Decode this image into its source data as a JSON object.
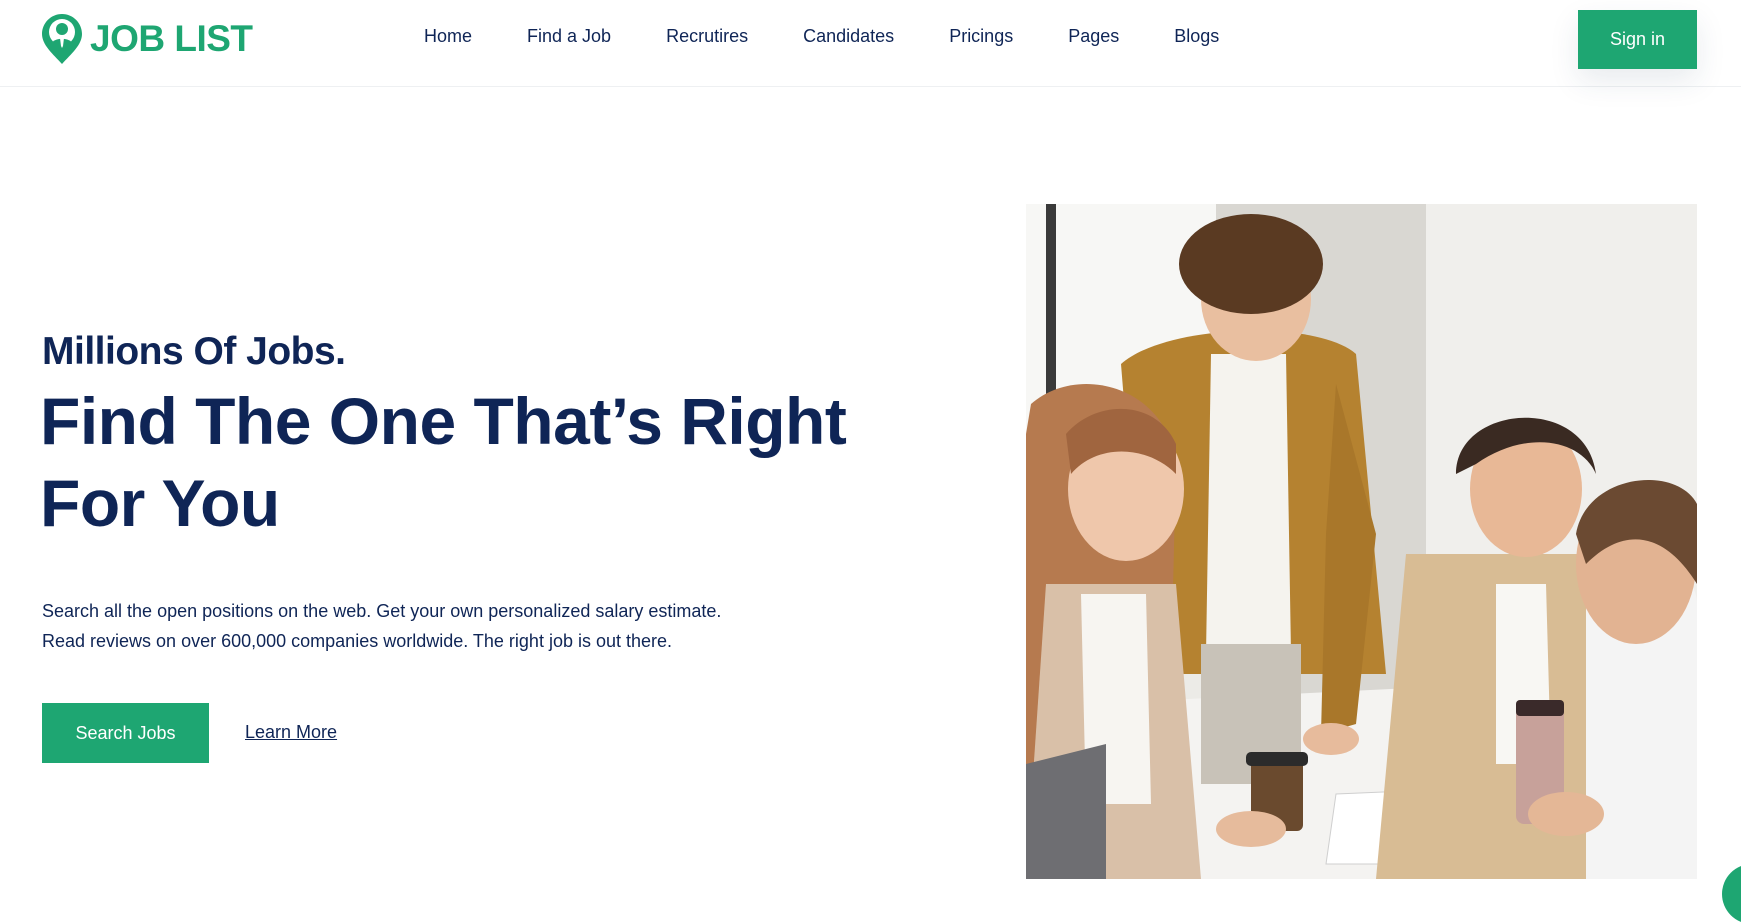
{
  "brand": {
    "name": "JOB LIST",
    "icon": "location-pin-person-icon",
    "color": "#1ea672"
  },
  "nav": {
    "items": [
      "Home",
      "Find a Job",
      "Recrutires",
      "Candidates",
      "Pricings",
      "Pages",
      "Blogs"
    ],
    "signin_label": "Sign in"
  },
  "hero": {
    "subtitle": "Millions Of Jobs.",
    "title_line1": "Find The One That’s Right",
    "title_line2": "For You",
    "desc_line1": "Search all the open positions on the web. Get your own personalized salary estimate.",
    "desc_line2": "Read reviews on over 600,000 companies worldwide. The right job is out there.",
    "primary_button": "Search Jobs",
    "secondary_link": "Learn More",
    "image": "team-meeting-photo"
  },
  "colors": {
    "accent": "#1ea672",
    "heading": "#0f2556"
  }
}
